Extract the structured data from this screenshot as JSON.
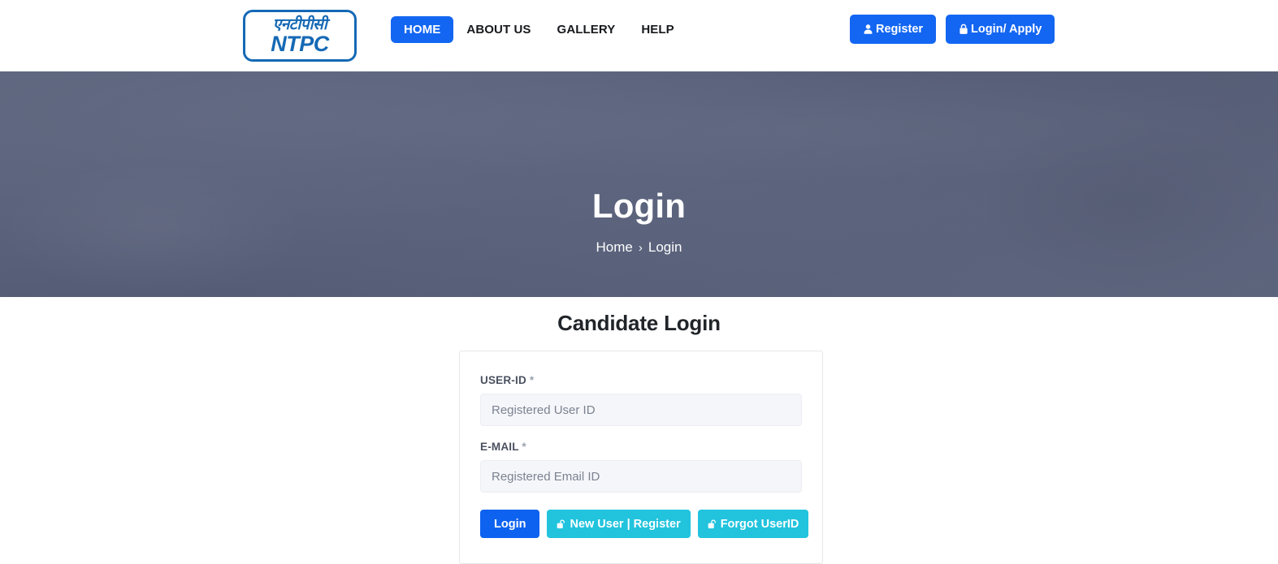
{
  "header": {
    "logo": {
      "devanagari_text": "एनटीपीसी",
      "latin_text": "NTPC",
      "brand_color": "#1569b5"
    },
    "nav": [
      {
        "label": "HOME",
        "active": true
      },
      {
        "label": "ABOUT US",
        "active": false
      },
      {
        "label": "GALLERY",
        "active": false
      },
      {
        "label": "HELP",
        "active": false
      }
    ],
    "actions": [
      {
        "label": "Register",
        "icon": "user-icon",
        "color": "#1366f2"
      },
      {
        "label": "Login/ Apply",
        "icon": "lock-icon",
        "color": "#1366f2"
      }
    ]
  },
  "hero": {
    "title": "Login",
    "background_color": "#585f79",
    "breadcrumb": {
      "home_label": "Home",
      "separator": "›",
      "current_label": "Login"
    }
  },
  "main": {
    "heading": "Candidate Login",
    "form": {
      "fields": [
        {
          "label": "USER-ID",
          "required_mark": "*",
          "placeholder": "Registered User ID",
          "value": ""
        },
        {
          "label": "E-MAIL",
          "required_mark": "*",
          "placeholder": "Registered Email ID",
          "value": ""
        }
      ],
      "buttons": [
        {
          "label": "Login",
          "icon": null,
          "color": "#0d62f0"
        },
        {
          "label": "New User | Register",
          "icon": "unlock-icon",
          "color": "#21c3dd"
        },
        {
          "label": "Forgot UserID",
          "icon": "unlock-icon",
          "color": "#21c3dd"
        }
      ]
    }
  }
}
